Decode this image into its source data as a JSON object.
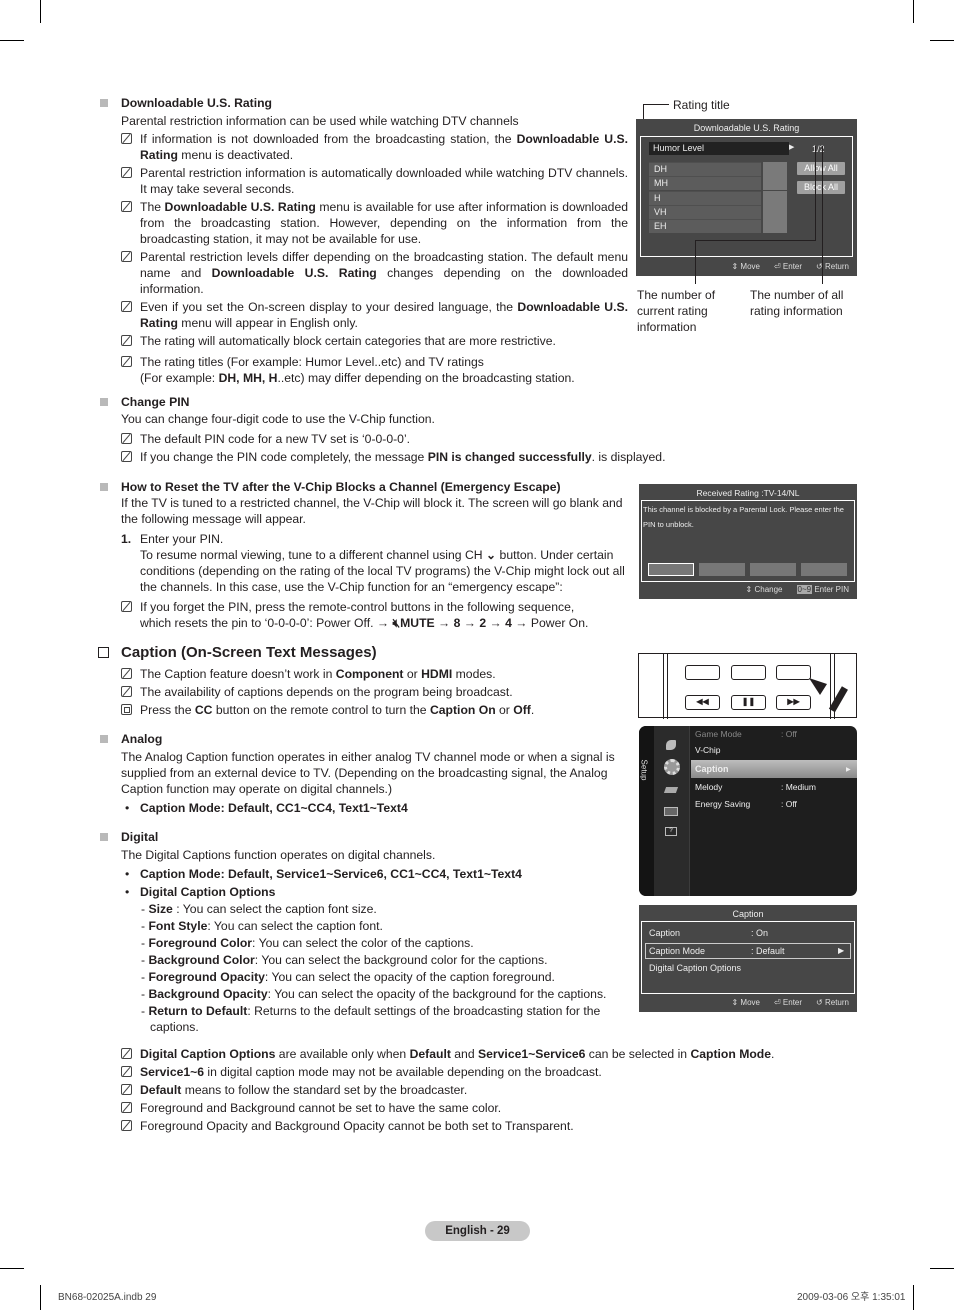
{
  "downloadable": {
    "heading": "Downloadable U.S. Rating",
    "intro": "Parental restriction information can be used while watching DTV channels",
    "notes": [
      {
        "pre": "If information is not downloaded from the broadcasting station, the ",
        "b1": "Downloadable U.S. Rating",
        "post": " menu is deactivated."
      },
      {
        "text": "Parental restriction information is automatically downloaded while watching DTV channels. It may take several seconds."
      },
      {
        "pre": "The ",
        "b1": "Downloadable U.S. Rating",
        "post": " menu is available for use after information is downloaded from the broadcasting station. However, depending on the information from the broadcasting station, it may not be available for use."
      },
      {
        "pre": "Parental restriction levels differ depending on the broadcasting station. The default menu name and ",
        "b1": "Downloadable U.S. Rating",
        "post": " changes depending on the downloaded information."
      },
      {
        "pre": "Even if you set the On-screen display to your desired language, the ",
        "b1": "Downloadable U.S. Rating",
        "post": " menu will appear in English only."
      },
      {
        "text": "The rating will automatically block certain categories that are more restrictive."
      },
      {
        "line1": "The rating titles (For example: Humor Level..etc) and TV ratings",
        "pre": "(For example: ",
        "b1": "DH, MH, H",
        "post": "..etc) may differ depending on the broadcasting station."
      }
    ]
  },
  "rating_osd": {
    "annotation_title": "Rating title",
    "title": "Downloadable U.S. Rating",
    "level": "Humor Level",
    "page": "1/2",
    "ratings": [
      "DH",
      "MH",
      "H",
      "VH",
      "EH"
    ],
    "allow_all": "Allow All",
    "block_all": "Block All",
    "footer": {
      "move": "Move",
      "enter": "Enter",
      "return": "Return"
    },
    "annotation_current": "The number of current rating information",
    "annotation_all": "The number of all rating information"
  },
  "change_pin": {
    "heading": "Change PIN",
    "intro": "You can change four-digit code to use the V-Chip function.",
    "note1": "The default PIN code for a new TV set is ‘0-0-0-0’.",
    "note2_pre": "If you change the PIN code completely, the message ",
    "note2_bold": "PIN is changed successfully",
    "note2_post": ". is displayed."
  },
  "reset": {
    "heading": "How to Reset the TV after the V-Chip Blocks a Channel (Emergency Escape)",
    "intro": "If the TV is tuned to a restricted channel, the V-Chip will block it. The screen will go blank and the following message will appear.",
    "step_num": "1.",
    "step_line1": "Enter your PIN.",
    "step_pre": "To resume normal viewing, tune to a different channel using CH ",
    "step_post": " button. Under certain conditions (depending on the rating of the local TV programs) the V-Chip might lock out all the channels. In this case, use the V-Chip function for an “emergency escape”:",
    "note_line1": "If you forget the PIN, press the remote-control buttons in the following sequence,",
    "note_pre": "which resets the pin to ‘0-0-0-0’: Power Off. → ",
    "note_mute": "MUTE",
    "note_seq": [
      " → ",
      "8",
      " → ",
      "2",
      " → ",
      "4",
      " → Power On."
    ]
  },
  "block_osd": {
    "title": "Received Rating :TV-14/NL",
    "message": "This channel is blocked by a Parental Lock. Please enter the PIN to unblock.",
    "footer_change": "Change",
    "footer_keys": "0~9",
    "footer_enter": "Enter  PIN"
  },
  "caption": {
    "heading": "Caption (On-Screen Text Messages)",
    "note1_pre": "The Caption feature doesn’t work in ",
    "note1_b1": "Component",
    "note1_mid": " or ",
    "note1_b2": "HDMI",
    "note1_post": " modes.",
    "note2": "The availability of captions depends on the program being broadcast.",
    "note3_pre": "Press the ",
    "note3_b1": "CC",
    "note3_mid": " button on the remote control to turn the ",
    "note3_b2": "Caption On",
    "note3_mid2": " or ",
    "note3_b3": "Off",
    "note3_post": ".",
    "analog_heading": "Analog",
    "analog_text": "The Analog Caption function operates in either analog TV channel mode or when a signal is supplied from an external device to TV. (Depending on the broadcasting signal, the Analog Caption function may operate on digital channels.)",
    "analog_bullet_label": "Caption Mode",
    "analog_bullet_value": ": Default, CC1~CC4, Text1~Text4",
    "digital_heading": "Digital",
    "digital_text": "The Digital Captions function operates on digital channels.",
    "digital_bullet1": "Caption Mode: Default, Service1~Service6, CC1~CC4, Text1~Text4",
    "digital_bullet2": "Digital Caption Options",
    "options": [
      {
        "name": "Size",
        "desc": " : You can select the caption font size."
      },
      {
        "name": "Font Style",
        "desc": ": You can select the caption font."
      },
      {
        "name": "Foreground Color",
        "desc": ": You can select the color of the captions."
      },
      {
        "name": "Background Color",
        "desc": ": You can select the background color for the captions."
      },
      {
        "name": "Foreground Opacity",
        "desc": ": You can select the opacity of the caption foreground."
      },
      {
        "name": "Background Opacity",
        "desc": ": You can select the opacity of the background for the captions."
      },
      {
        "name": "Return to Default",
        "desc": ": Returns to the default settings of the broadcasting station for the captions."
      }
    ],
    "end_notes": [
      {
        "b1": "Digital Caption Options",
        "t1": " are available only when ",
        "b2": "Default",
        "t2": " and ",
        "b3": "Service1~Service6",
        "t3": " can be selected in ",
        "b4": "Caption Mode",
        "t4": "."
      },
      {
        "b1": "Service1~6",
        "t1": " in digital caption mode may not be available depending on the broadcast."
      },
      {
        "b1": "Default",
        "t1": " means to follow the standard set by the broadcaster."
      },
      {
        "t1": "Foreground and Background cannot be set to have the same color."
      },
      {
        "t1": "Foreground Opacity and Background Opacity cannot be both set to Transparent."
      }
    ]
  },
  "setup_osd": {
    "side_label": "Setup",
    "items": [
      {
        "label": "Game Mode",
        "value": ": Off"
      },
      {
        "label": "V-Chip",
        "value": ""
      },
      {
        "label": "Caption",
        "value": ""
      },
      {
        "label": "Melody",
        "value": ": Medium"
      },
      {
        "label": "Energy Saving",
        "value": ": Off"
      }
    ]
  },
  "caption_osd": {
    "title": "Caption",
    "rows": [
      {
        "label": "Caption",
        "value": ": On"
      },
      {
        "label": "Caption Mode",
        "value": ": Default"
      },
      {
        "label": "Digital Caption Options",
        "value": ""
      }
    ],
    "footer": {
      "move": "Move",
      "enter": "Enter",
      "return": "Return"
    }
  },
  "remote": {
    "keys": [
      "◀◀",
      "❚❚",
      "▶▶"
    ]
  },
  "page": {
    "label": "English - 29",
    "file": "BN68-02025A.indb   29",
    "timestamp": "2009-03-06   오후 1:35:01"
  }
}
